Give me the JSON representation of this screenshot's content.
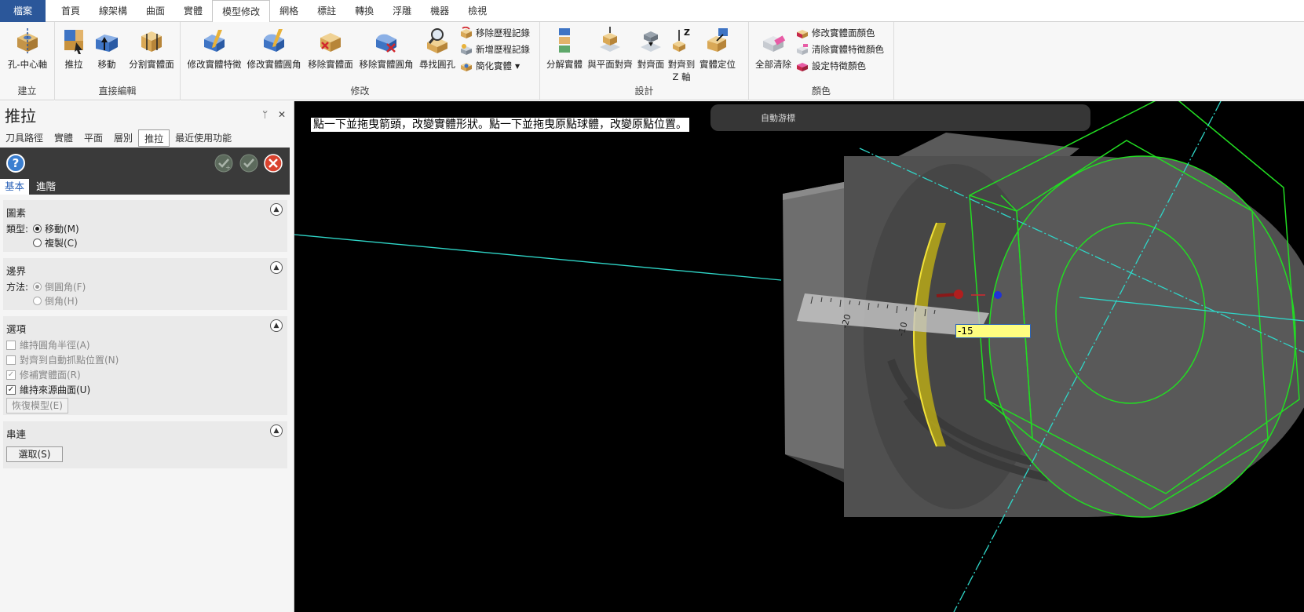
{
  "tabs": [
    {
      "label": "檔案"
    },
    {
      "label": "首頁"
    },
    {
      "label": "線架構"
    },
    {
      "label": "曲面"
    },
    {
      "label": "實體"
    },
    {
      "label": "模型修改"
    },
    {
      "label": "網格"
    },
    {
      "label": "標註"
    },
    {
      "label": "轉換"
    },
    {
      "label": "浮雕"
    },
    {
      "label": "機器"
    },
    {
      "label": "檢視"
    }
  ],
  "ribbon": {
    "groups": {
      "create": "建立",
      "direct_edit": "直接編輯",
      "modify": "修改",
      "design": "設計",
      "color": "顏色"
    },
    "buttons": {
      "hole_axis": "孔-中心軸",
      "push_pull": "推拉",
      "move": "移動",
      "split_face": "分割實體面",
      "modify_feature": "修改實體特徵",
      "modify_fillet": "修改實體圓角",
      "remove_face": "移除實體面",
      "remove_fillet": "移除實體圓角",
      "find_hole": "尋找圓孔",
      "remove_history": "移除歷程記錄",
      "add_history": "新增歷程記錄",
      "simplify": "簡化實體",
      "disassemble": "分解實體",
      "align_plane": "與平面對齊",
      "align_face": "對齊面",
      "align_z_1": "對齊到",
      "align_z_2": "Z 軸",
      "solid_position": "實體定位",
      "clear_all": "全部清除",
      "modify_face_color": "修改實體面顏色",
      "clear_feature_color": "清除實體特徵顏色",
      "set_feature_color": "設定特徵顏色"
    }
  },
  "panel": {
    "title": "推拉",
    "pin": "ᛘ",
    "close": "✕",
    "subtabs": [
      {
        "label": "刀具路徑"
      },
      {
        "label": "實體"
      },
      {
        "label": "平面"
      },
      {
        "label": "層別"
      },
      {
        "label": "推拉"
      },
      {
        "label": "最近使用功能"
      }
    ],
    "help": "?",
    "basic_tab": "基本",
    "advanced_tab": "進階",
    "sections": {
      "element": {
        "title": "圖素",
        "type_label": "類型:",
        "opt_move": "移動(M)",
        "opt_copy": "複製(C)"
      },
      "boundary": {
        "title": "邊界",
        "method_label": "方法:",
        "opt_fillet": "倒圓角(F)",
        "opt_chamfer": "倒角(H)"
      },
      "options": {
        "title": "選項",
        "keep_radius": "維持圓角半徑(A)",
        "align_snap": "對齊到自動抓點位置(N)",
        "repair_solid": "修補實體面(R)",
        "keep_source": "維持來源曲面(U)",
        "restore": "恢復模型(E)"
      },
      "chain": {
        "title": "串連",
        "select": "選取(S)"
      }
    }
  },
  "viewport": {
    "hint": "點一下並拖曳箭頭，改變實體形狀。點一下並拖曳原點球體，改變原點位置。",
    "value": "-15",
    "toolbar_label": "自動游標",
    "ruler_labels": [
      "-20",
      "-10"
    ],
    "colors": {
      "background": "#000000",
      "wire": "#22dd22",
      "axis": "#2fd6c8",
      "preview": "#e6d21a"
    }
  }
}
